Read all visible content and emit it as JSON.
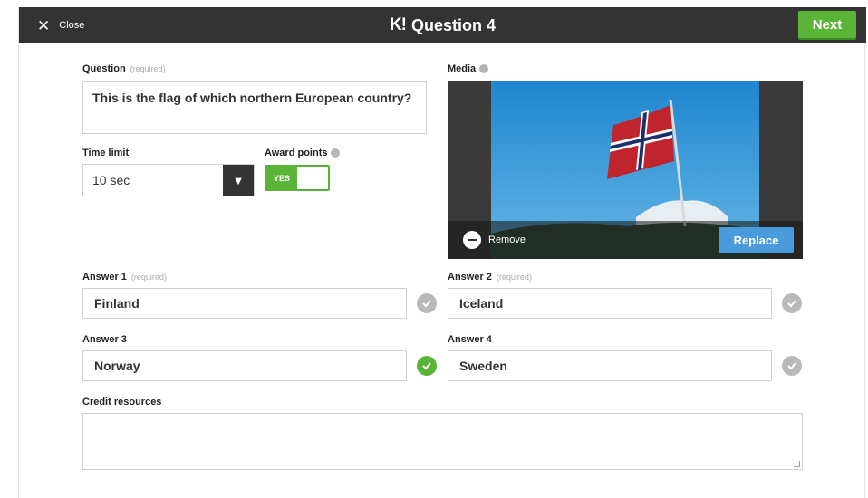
{
  "topbar": {
    "close_label": "Close",
    "logo": "K!",
    "title": "Question 4",
    "next_label": "Next"
  },
  "question": {
    "label": "Question",
    "required_note": "(required)",
    "text": "This is the flag of which northern European country?"
  },
  "time_limit": {
    "label": "Time limit",
    "value": "10 sec"
  },
  "award_points": {
    "label": "Award points",
    "toggle_label": "YES",
    "on": true
  },
  "media": {
    "label": "Media",
    "remove_label": "Remove",
    "replace_label": "Replace"
  },
  "answers": [
    {
      "label": "Answer 1",
      "required_note": "(required)",
      "value": "Finland",
      "correct": false
    },
    {
      "label": "Answer 2",
      "required_note": "(required)",
      "value": "Iceland",
      "correct": false
    },
    {
      "label": "Answer 3",
      "required_note": "",
      "value": "Norway",
      "correct": true
    },
    {
      "label": "Answer 4",
      "required_note": "",
      "value": "Sweden",
      "correct": false
    }
  ],
  "credit_resources": {
    "label": "Credit resources",
    "value": ""
  },
  "colors": {
    "topbar": "#333333",
    "accent_green": "#5ab437",
    "replace_blue": "#4a9bdc",
    "check_gray": "#b9b9b9"
  }
}
